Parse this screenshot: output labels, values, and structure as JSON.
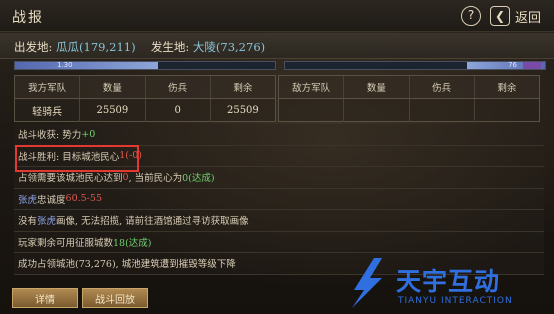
{
  "header": {
    "title": "战报",
    "help_label": "?",
    "back_label": "返回"
  },
  "location": {
    "origin_label": "出发地:",
    "origin_value": "瓜瓜(179,211)",
    "battle_label": "发生地:",
    "battle_value": "大陵(73,276)"
  },
  "strength": {
    "left_value": "1.30",
    "right_value": "76",
    "left_fill": 0.55,
    "right_fill": 0.3
  },
  "tables": {
    "my_headers": [
      "我方军队",
      "数量",
      "伤兵",
      "剩余"
    ],
    "my_row": [
      "轻骑兵",
      "25509",
      "0",
      "25509"
    ],
    "enemy_headers": [
      "敌方军队",
      "数量",
      "伤兵",
      "剩余"
    ]
  },
  "report": {
    "l1_text": "战斗收获: 势力",
    "l1_val": "+0",
    "l2_text": "战斗胜利: 目标城池民心",
    "l2_val": "1(-0)",
    "l3_text_a": "占领需要该城池民心达到",
    "l3_val_a": "0",
    "l3_text_b": ", 当前民心为",
    "l3_val_b": "0(达成)",
    "l4_name": "张虎",
    "l4_text": "忠诚度",
    "l4_val": "60.5-55",
    "l5_text_a": "没有",
    "l5_name": "张虎",
    "l5_text_b": "画像, 无法招揽, 请前往酒馆通过寻访获取画像",
    "l6_text": "玩家剩余可用征服城数",
    "l6_val": "18(达成)",
    "l7_text": "成功占领城池(73,276), 城池建筑遭到摧毁等级下降"
  },
  "buttons": {
    "details": "详情",
    "replay": "战斗回放"
  },
  "watermark": {
    "cn": "天宇互动",
    "en": "TIANYU INTERACTION"
  },
  "colors": {
    "accent_green": "#6fd26f",
    "accent_red": "#e25a4e",
    "accent_blue": "#8da6e8",
    "highlight_red": "#e23a32",
    "watermark_blue": "#2f6fe0"
  }
}
